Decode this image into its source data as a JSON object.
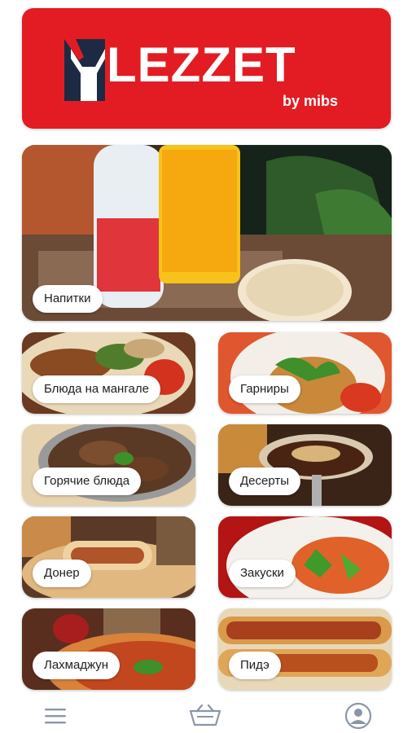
{
  "brand": {
    "logo_text": "LEZZET",
    "logo_sub": "by mibs",
    "color": "#e31c23"
  },
  "categories": [
    {
      "label": "Напитки"
    },
    {
      "label": "Блюда на мангале"
    },
    {
      "label": "Гарниры"
    },
    {
      "label": "Горячие блюда"
    },
    {
      "label": "Десерты"
    },
    {
      "label": "Донер"
    },
    {
      "label": "Закуски"
    },
    {
      "label": "Лахмаджун"
    },
    {
      "label": "Пидэ"
    }
  ],
  "bottom_nav": {
    "items": [
      {
        "icon": "menu-icon"
      },
      {
        "icon": "basket-icon"
      },
      {
        "icon": "profile-icon"
      }
    ]
  }
}
